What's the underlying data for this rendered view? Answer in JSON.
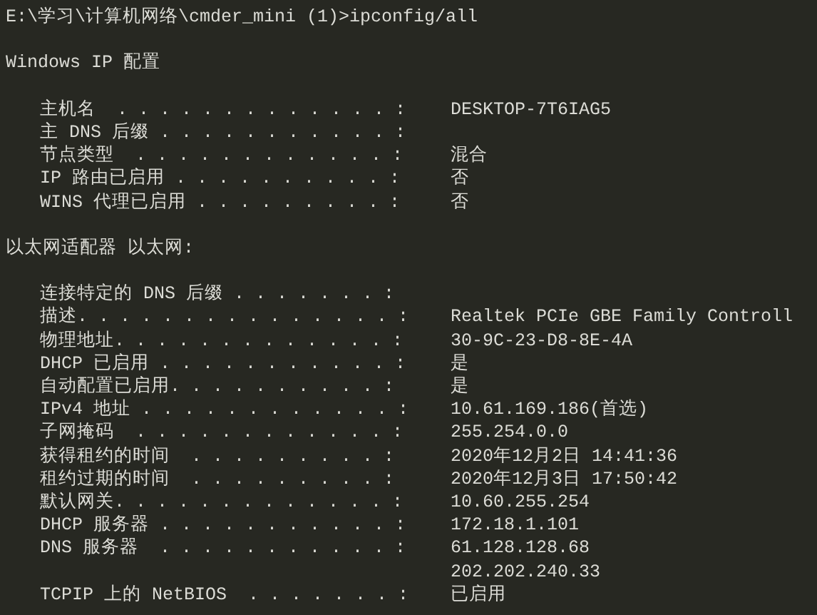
{
  "terminal": {
    "prompt": "E:\\学习\\计算机网络\\cmder_mini (1)>ipconfig/all",
    "sections": [
      {
        "heading": "Windows IP 配置",
        "entries": [
          {
            "label": "主机名  . . . . . . . . . . . . . :",
            "values": [
              "DESKTOP-7T6IAG5"
            ]
          },
          {
            "label": "主 DNS 后缀 . . . . . . . . . . . :"
          },
          {
            "label": "节点类型  . . . . . . . . . . . . :",
            "values": [
              "混合"
            ]
          },
          {
            "label": "IP 路由已启用 . . . . . . . . . . :",
            "values": [
              "否"
            ]
          },
          {
            "label": "WINS 代理已启用 . . . . . . . . . :",
            "values": [
              "否"
            ]
          }
        ]
      },
      {
        "heading": "以太网适配器 以太网:",
        "entries": [
          {
            "label": "连接特定的 DNS 后缀 . . . . . . . :"
          },
          {
            "label": "描述. . . . . . . . . . . . . . . :",
            "values": [
              "Realtek PCIe GBE Family Controll"
            ]
          },
          {
            "label": "物理地址. . . . . . . . . . . . . :",
            "values": [
              "30-9C-23-D8-8E-4A"
            ]
          },
          {
            "label": "DHCP 已启用 . . . . . . . . . . . :",
            "values": [
              "是"
            ]
          },
          {
            "label": "自动配置已启用. . . . . . . . . . :",
            "values": [
              "是"
            ]
          },
          {
            "label": "IPv4 地址 . . . . . . . . . . . . :",
            "values": [
              "10.61.169.186(首选)"
            ]
          },
          {
            "label": "子网掩码  . . . . . . . . . . . . :",
            "values": [
              "255.254.0.0"
            ]
          },
          {
            "label": "获得租约的时间  . . . . . . . . . :",
            "values": [
              "2020年12月2日 14:41:36"
            ]
          },
          {
            "label": "租约过期的时间  . . . . . . . . . :",
            "values": [
              "2020年12月3日 17:50:42"
            ]
          },
          {
            "label": "默认网关. . . . . . . . . . . . . :",
            "values": [
              "10.60.255.254"
            ]
          },
          {
            "label": "DHCP 服务器 . . . . . . . . . . . :",
            "values": [
              "172.18.1.101"
            ]
          },
          {
            "label": "DNS 服务器  . . . . . . . . . . . :",
            "values": [
              "61.128.128.68",
              "202.202.240.33"
            ]
          },
          {
            "label": "TCPIP 上的 NetBIOS  . . . . . . . :",
            "values": [
              "已启用"
            ]
          }
        ]
      }
    ]
  }
}
